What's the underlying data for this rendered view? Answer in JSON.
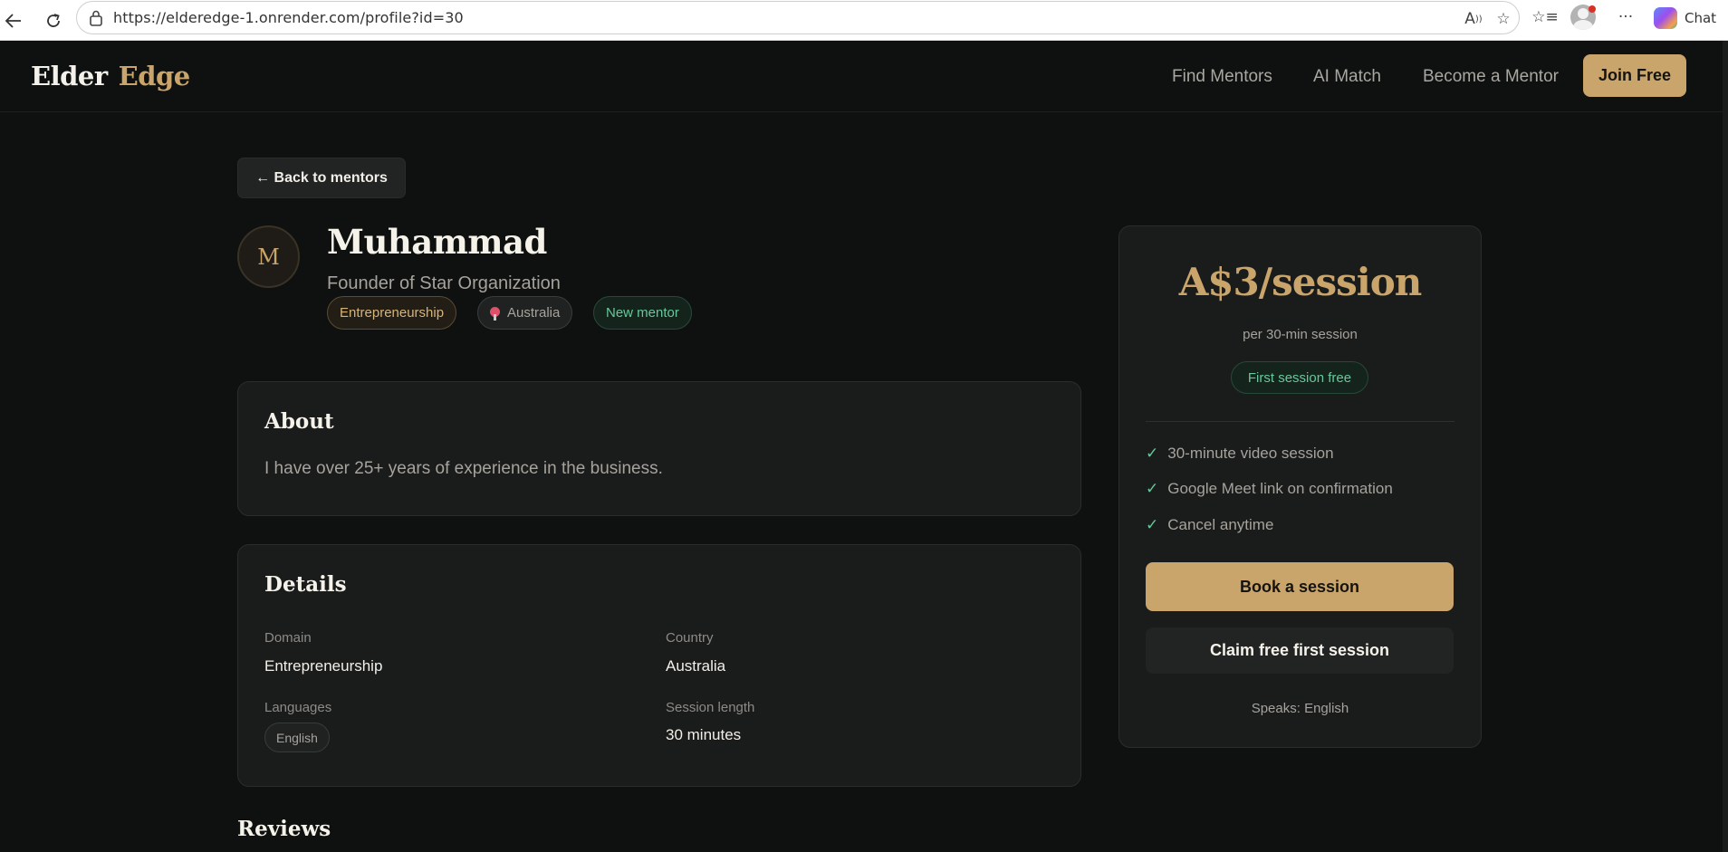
{
  "browser": {
    "url": "https://elderedge-1.onrender.com/profile?id=30",
    "chat_label": "Chat"
  },
  "nav": {
    "brand_first": "Elder",
    "brand_second": "Edge",
    "links": [
      "Find Mentors",
      "AI Match",
      "Become a Mentor"
    ],
    "join_label": "Join Free"
  },
  "back_label": "← Back to mentors",
  "mentor": {
    "initial": "M",
    "name": "Muhammad",
    "title": "Founder of Star Organization",
    "tags": {
      "domain": "Entrepreneurship",
      "country": "Australia",
      "status": "New mentor"
    }
  },
  "about": {
    "heading": "About",
    "text": "I have over 25+ years of experience in the business."
  },
  "details": {
    "heading": "Details",
    "domain_label": "Domain",
    "domain_value": "Entrepreneurship",
    "country_label": "Country",
    "country_value": "Australia",
    "languages_label": "Languages",
    "languages": [
      "English"
    ],
    "session_label": "Session length",
    "session_value": "30 minutes"
  },
  "reviews_heading": "Reviews",
  "pricing": {
    "price": "A$3/session",
    "subtitle": "per 30-min session",
    "free_badge": "First session free",
    "features": [
      "30-minute video session",
      "Google Meet link on confirmation",
      "Cancel anytime"
    ],
    "book_label": "Book a session",
    "claim_label": "Claim free first session",
    "speaks": "Speaks: English"
  },
  "colors": {
    "background": "#0f1010",
    "card": "#1a1b1b",
    "accent_gold": "#c9a46b",
    "accent_green": "#66c99a"
  },
  "icons": [
    "back-arrow-icon",
    "reload-icon",
    "lock-icon",
    "read-aloud-icon",
    "favorite-star-icon",
    "favorites-icon",
    "more-icon",
    "pin-icon",
    "check-icon"
  ]
}
